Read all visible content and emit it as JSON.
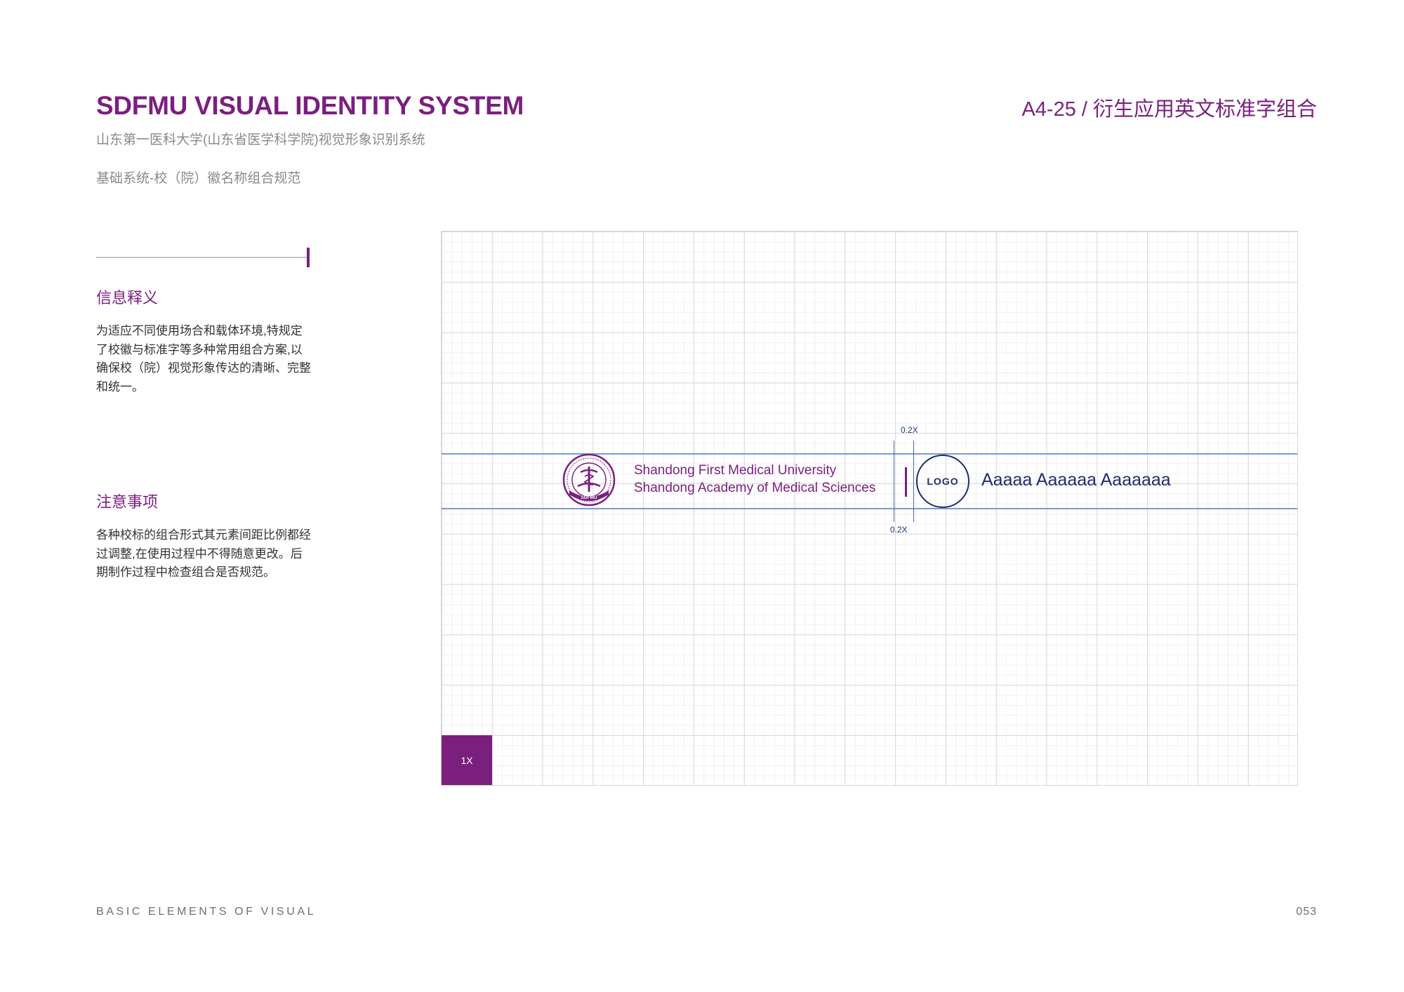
{
  "header": {
    "title": "SDFMU VISUAL IDENTITY SYSTEM",
    "subtitle": "山东第一医科大学(山东省医学科学院)视觉形象识别系统",
    "section": "基础系统-校（院）徽名称组合规范",
    "page_code": "A4-25 /  衍生应用英文标准字组合"
  },
  "info": {
    "heading": "信息释义",
    "lines": [
      "为适应不同使用场合和载体环境,特规定",
      "了校徽与标准字等多种常用组合方案,以",
      "确保校（院）视觉形象传达的清晰、完整",
      "和统一。"
    ]
  },
  "notes": {
    "heading": "注意事项",
    "lines": [
      "各种校标的组合形式其元素间距比例都经",
      "过调整,在使用过程中不得随意更改。后",
      "期制作过程中检查组合是否规范。"
    ]
  },
  "diagram": {
    "name_line1": "Shandong First Medical University",
    "name_line2": "Shandong Academy of Medical Sciences",
    "dim_top": "0.2X",
    "dim_bottom": "0.2X",
    "logo_label": "LOGO",
    "logo_text": "Aaaaa Aaaaaa Aaaaaaa",
    "unit_label": "1X",
    "seal_text": "SDFMU"
  },
  "footer": {
    "left": "BASIC ELEMENTS OF VISUAL",
    "page_number": "053"
  },
  "colors": {
    "brand_purple": "#7b1f7e",
    "navy": "#1f2d6e",
    "guide_blue": "#7b9bcf"
  }
}
